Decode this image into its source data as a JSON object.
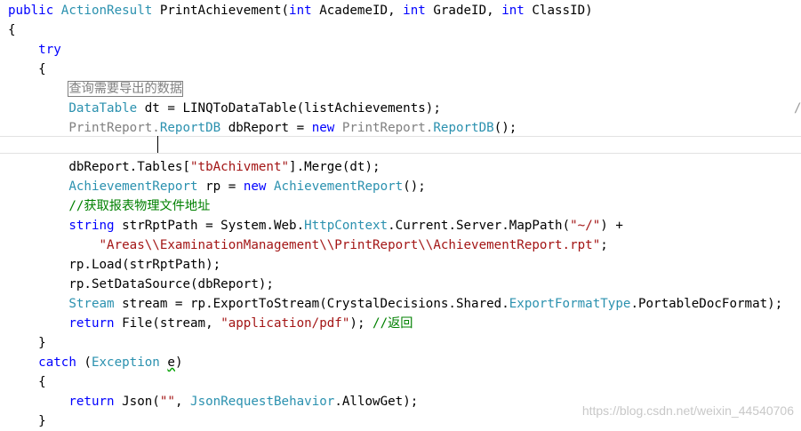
{
  "lines": [
    [
      [
        "public ",
        "kw"
      ],
      [
        "ActionResult",
        "ty"
      ],
      [
        " PrintAchievement(",
        "pl"
      ],
      [
        "int",
        "kw"
      ],
      [
        " AcademeID, ",
        "pl"
      ],
      [
        "int",
        "kw"
      ],
      [
        " GradeID, ",
        "pl"
      ],
      [
        "int",
        "kw"
      ],
      [
        " ClassID)",
        "pl"
      ]
    ],
    [
      [
        "{",
        "pl"
      ]
    ],
    [
      [
        "    try",
        "kw"
      ]
    ],
    [
      [
        "    {",
        "pl"
      ]
    ],
    [
      [
        "        ",
        "pl"
      ],
      [
        "查询需要导出的数据",
        "boxed"
      ]
    ],
    [
      [
        "        ",
        "pl"
      ],
      [
        "DataTable",
        "ty"
      ],
      [
        " dt = LINQToDataTable(listAchievements);",
        "pl"
      ]
    ],
    [
      [
        "        PrintReport.",
        "gr"
      ],
      [
        "ReportDB",
        "ty"
      ],
      [
        " dbReport = ",
        "pl"
      ],
      [
        "new",
        "kw"
      ],
      [
        " PrintReport.",
        "gr"
      ],
      [
        "ReportDB",
        "ty"
      ],
      [
        "();",
        "pl"
      ]
    ],
    [],
    [
      [
        "        dbReport.Tables[",
        "pl"
      ],
      [
        "\"tbAchivment\"",
        "str"
      ],
      [
        "].Merge(dt);",
        "pl"
      ]
    ],
    [
      [
        "        ",
        "pl"
      ],
      [
        "AchievementReport",
        "ty"
      ],
      [
        " rp = ",
        "pl"
      ],
      [
        "new",
        "kw"
      ],
      [
        " ",
        "pl"
      ],
      [
        "AchievementReport",
        "ty"
      ],
      [
        "();",
        "pl"
      ]
    ],
    [
      [
        "        //获取报表物理文件地址",
        "cm"
      ]
    ],
    [
      [
        "        ",
        "pl"
      ],
      [
        "string",
        "kw"
      ],
      [
        " strRptPath = System.Web.",
        "pl"
      ],
      [
        "HttpContext",
        "ty"
      ],
      [
        ".Current.Server.MapPath(",
        "pl"
      ],
      [
        "\"~/\"",
        "str"
      ],
      [
        ") +",
        "pl"
      ]
    ],
    [
      [
        "            ",
        "pl"
      ],
      [
        "\"Areas\\\\ExaminationManagement\\\\PrintReport\\\\AchievementReport.rpt\"",
        "str"
      ],
      [
        ";",
        "pl"
      ]
    ],
    [
      [
        "        rp.Load(strRptPath);",
        "pl"
      ]
    ],
    [
      [
        "        rp.SetDataSource(dbReport);",
        "pl"
      ]
    ],
    [
      [
        "        ",
        "pl"
      ],
      [
        "Stream",
        "ty"
      ],
      [
        " stream = rp.ExportToStream(CrystalDecisions.Shared.",
        "pl"
      ],
      [
        "ExportFormatType",
        "ty"
      ],
      [
        ".PortableDocFormat);",
        "pl"
      ]
    ],
    [
      [
        "        ",
        "pl"
      ],
      [
        "return",
        "kw"
      ],
      [
        " File(stream, ",
        "pl"
      ],
      [
        "\"application/pdf\"",
        "str"
      ],
      [
        "); ",
        "pl"
      ],
      [
        "//返回",
        "cm"
      ]
    ],
    [
      [
        "    }",
        "pl"
      ]
    ],
    [
      [
        "    catch",
        "kw"
      ],
      [
        " (",
        "pl"
      ],
      [
        "Exception",
        "ty"
      ],
      [
        " ",
        "pl"
      ],
      [
        "e",
        "squig"
      ],
      [
        ")",
        "pl"
      ]
    ],
    [
      [
        "    {",
        "pl"
      ]
    ],
    [
      [
        "        ",
        "pl"
      ],
      [
        "return",
        "kw"
      ],
      [
        " Json(",
        "pl"
      ],
      [
        "\"\"",
        "str"
      ],
      [
        ", ",
        "pl"
      ],
      [
        "JsonRequestBehavior",
        "ty"
      ],
      [
        ".AllowGet);",
        "pl"
      ]
    ],
    [
      [
        "    }",
        "pl"
      ]
    ]
  ],
  "trailing_slash": "/",
  "watermark": "https://blog.csdn.net/weixin_44540706",
  "colors": {
    "keyword": "#0000ff",
    "type": "#2b91af",
    "string": "#a31515",
    "comment": "#008000",
    "grey": "#808080"
  }
}
